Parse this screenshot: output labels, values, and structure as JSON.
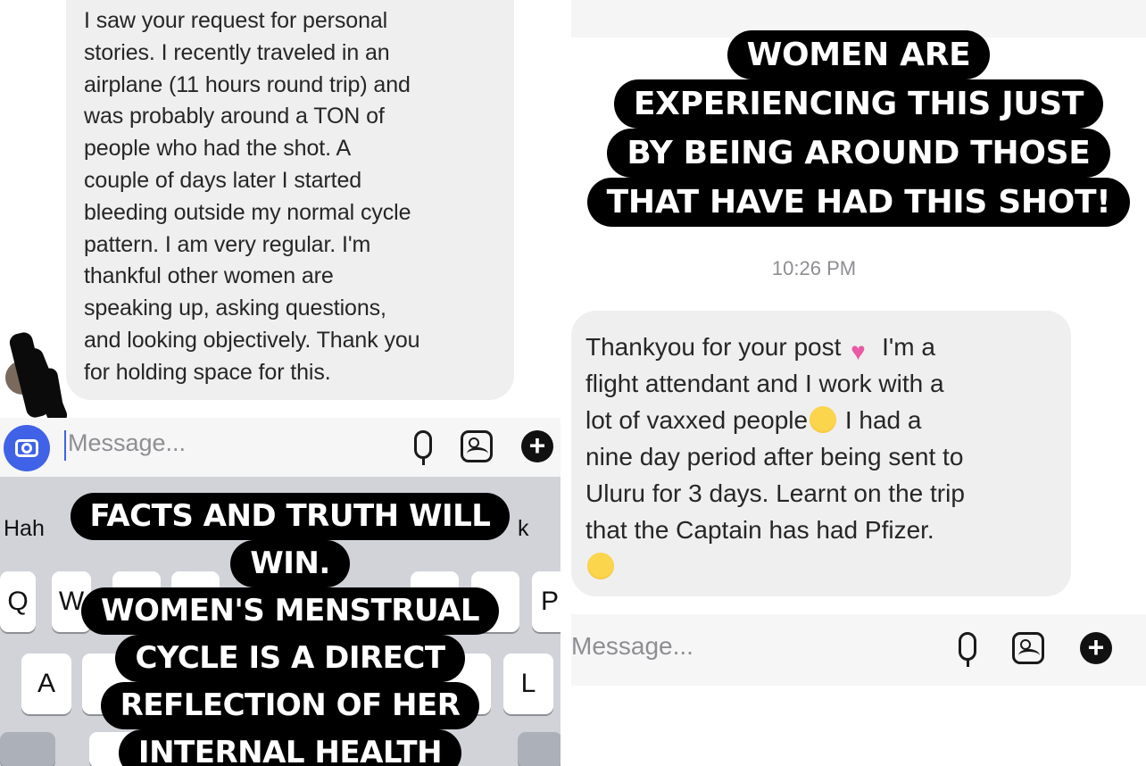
{
  "left_panel": {
    "incoming_message": {
      "text": "I saw your request for personal\nstories. I recently traveled in an\nairplane (11 hours round trip) and\nwas probably around a TON of\npeople who had the shot. A\ncouple of days later I started\nbleeding outside my normal cycle\npattern. I am very regular.  I'm\nthankful other women are\nspeaking up, asking questions,\nand looking objectively. Thank you\nfor holding space for this."
    },
    "composer": {
      "placeholder": "Message...",
      "icons": [
        "camera-icon",
        "microphone-icon",
        "image-icon",
        "plus-icon"
      ]
    },
    "keyboard": {
      "suggestion_visible": "Hah",
      "suggestion_right": "k",
      "visible_keys": [
        "Q",
        "W",
        "P",
        "A",
        "L"
      ]
    },
    "story_overlay": {
      "lines": [
        "FACTS AND TRUTH WILL",
        "WIN.",
        "WOMEN'S MENSTRUAL",
        "CYCLE IS A DIRECT",
        "REFLECTION OF HER",
        "INTERNAL HEALTH"
      ]
    }
  },
  "right_panel": {
    "story_overlay": {
      "lines": [
        "WOMEN ARE",
        "EXPERIENCING THIS JUST",
        "BY BEING AROUND THOSE",
        "THAT HAVE HAD THIS SHOT!"
      ]
    },
    "timestamp": "10:26 PM",
    "incoming_message": {
      "part1": "Thankyou for your post",
      "part2": " I'm a\nflight attendant and I work with a\nlot of vaxxed people",
      "part3": " I had a\nnine day period after being sent to\nUluru for 3 days. Learnt on the trip\nthat the Captain has had Pfizer.\n",
      "emojis": [
        "pink-heart-emoji",
        "crying-face-emoji",
        "pleading-face-emoji"
      ]
    },
    "composer": {
      "placeholder": "Message...",
      "icons": [
        "microphone-icon",
        "image-icon",
        "plus-icon"
      ]
    }
  },
  "colors": {
    "bubble_background": "#efeff0",
    "story_background": "#000000",
    "story_text": "#ffffff",
    "camera_button": "#3f62e6",
    "keyboard_background": "#d1d3d9"
  }
}
